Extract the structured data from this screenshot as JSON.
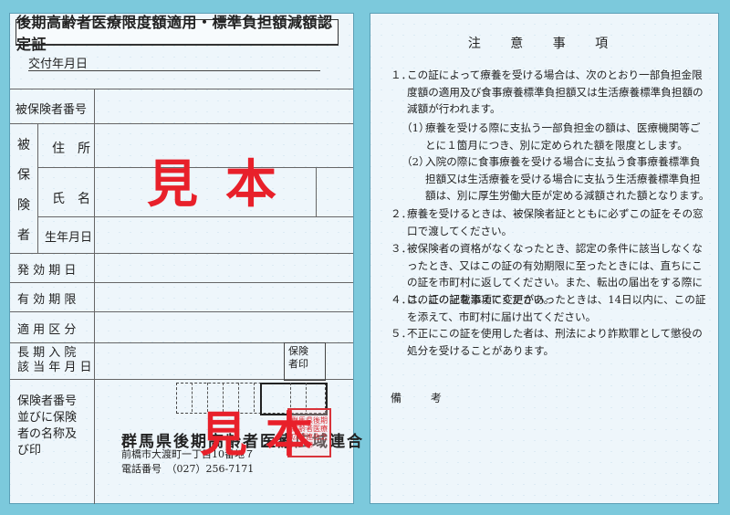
{
  "front": {
    "title": "後期高齢者医療限度額適用・標準負担額減額認定証",
    "issue_date_label": "交付年月日",
    "rows": {
      "insured_number": "被保険者番号",
      "insured_person_vertical": [
        "被",
        "保",
        "険",
        "者"
      ],
      "address": "住　所",
      "name": "氏　名",
      "birthdate": "生年月日",
      "effective_date": "発 効 期 日",
      "expiry_date": "有 効 期 限",
      "category": "適 用 区 分",
      "long_term_line1": "長 期 入 院",
      "long_term_line2": "該 当 年 月 日",
      "insurer_seal": "保険\n者印",
      "insurer_info": "保険者番号\n並びに保険\n者の名称及\nび印"
    },
    "insurer": {
      "name": "群馬県後期高齢者医療広域連合",
      "address": "前橋市大渡町一丁目10番地７",
      "phone": "電話番号　（027）256-7171"
    },
    "seal_text": "群馬県後期高齢者医療広域連合之印",
    "watermark": "見本"
  },
  "back": {
    "title": "注 意 事 項",
    "notes": [
      {
        "num": "１．",
        "text": "この証によって療養を受ける場合は、次のとおり一部負担金限度額の適用及び食事療養標準負担額又は生活療養標準負担額の減額が行われます。"
      },
      {
        "num": "（1）",
        "text": "療養を受ける際に支払う一部負担金の額は、医療機関等ごとに１箇月につき、別に定められた額を限度とします。"
      },
      {
        "num": "（2）",
        "text": "入院の際に食事療養を受ける場合に支払う食事療養標準負担額又は生活療養を受ける場合に支払う生活療養標準負担額は、別に厚生労働大臣が定める減額された額となります。"
      },
      {
        "num": "２．",
        "text": "療養を受けるときは、被保険者証とともに必ずこの証をその窓口で渡してください。"
      },
      {
        "num": "３．",
        "text": "被保険者の資格がなくなったとき、認定の条件に該当しなくなったとき、又はこの証の有効期限に至ったときには、直ちにこの証を市町村に返してください。また、転出の届出をする際には、この証を添えてください。"
      },
      {
        "num": "４．",
        "text": "この証の記載事項に変更があったときは、14日以内に、この証を添えて、市町村に届け出てください。"
      },
      {
        "num": "５．",
        "text": "不正にこの証を使用した者は、刑法により詐欺罪として懲役の処分を受けることがあります。"
      }
    ],
    "remarks": "備 考"
  },
  "colors": {
    "background": "#7cc9dc",
    "card": "#eef6fb",
    "watermark": "#e8202a",
    "seal": "#d9333a"
  }
}
